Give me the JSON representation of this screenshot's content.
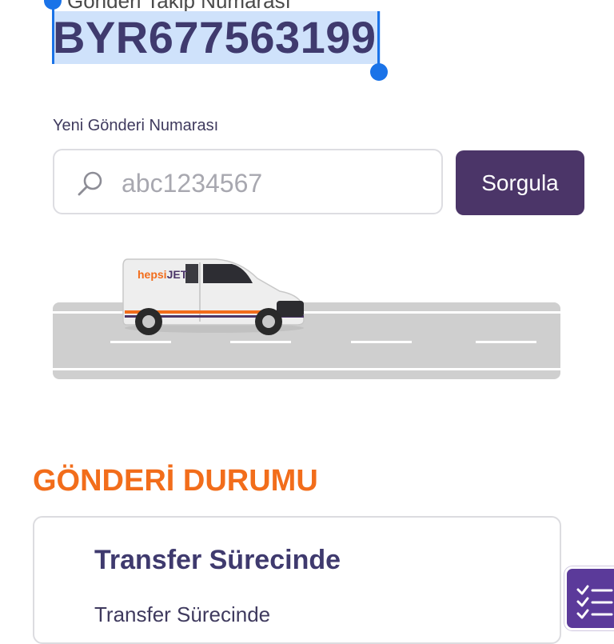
{
  "tracking": {
    "label": "Gönderi Takip Numarası",
    "number": "BYR677563199"
  },
  "search": {
    "label": "Yeni Gönderi Numarası",
    "placeholder": "abc1234567",
    "value": "",
    "button_label": "Sorgula"
  },
  "illustration": {
    "van_brand": "hepsiJET",
    "van_brand_part1": "hepsi",
    "van_brand_part2": "JET"
  },
  "status": {
    "section_title": "GÖNDERİ DURUMU",
    "card_title": "Transfer Sürecinde",
    "card_subtitle": "Transfer Sürecinde"
  },
  "colors": {
    "primary": "#4b3568",
    "accent": "#f26d1b",
    "heading": "#3f3a6e",
    "selection": "#cfe2fb",
    "selection_handle": "#1a73e8"
  },
  "icons": {
    "search": "search-icon",
    "tasks": "task-list-icon"
  }
}
